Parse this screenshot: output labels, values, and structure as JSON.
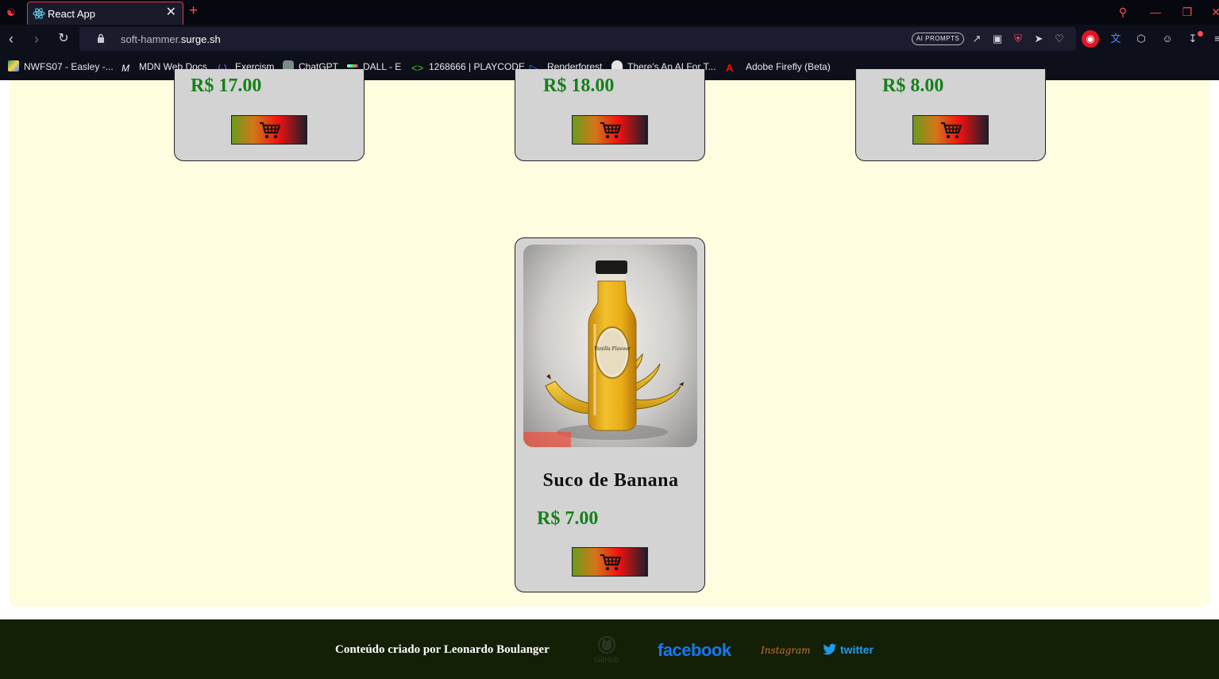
{
  "browser": {
    "tab_title": "React App",
    "url_host": "soft-hammer.",
    "url_domain": "surge.sh",
    "ai_prompts_label": "AI PROMPTS",
    "bookmarks": [
      {
        "label": "NWFS07 - Easley -..."
      },
      {
        "label": "MDN Web Docs"
      },
      {
        "label": "Exercism"
      },
      {
        "label": "ChatGPT"
      },
      {
        "label": "DALL - E"
      },
      {
        "label": "1268666 | PLAYCODE"
      },
      {
        "label": "Renderforest"
      },
      {
        "label": "There's An AI For T..."
      },
      {
        "label": "Adobe Firefly (Beta)"
      }
    ]
  },
  "products_top_row": [
    {
      "price": "R$ 17.00"
    },
    {
      "price": "R$ 18.00"
    },
    {
      "price": "R$ 8.00"
    }
  ],
  "product_featured": {
    "title": "Suco de Banana",
    "price": "R$ 7.00",
    "image_label": "Vanilla Flavour"
  },
  "footer": {
    "credit": "Conteúdo criado por Leonardo Boulanger",
    "github_label": "GitHub",
    "facebook_label": "facebook",
    "instagram_label": "Instagram",
    "twitter_label": "twitter"
  },
  "colors": {
    "page_background": "#fffde0",
    "card_background": "#d3d3d3",
    "price_green": "#16801a",
    "footer_background": "#132006",
    "facebook_blue": "#1877f2",
    "twitter_blue": "#1d9bf0"
  }
}
